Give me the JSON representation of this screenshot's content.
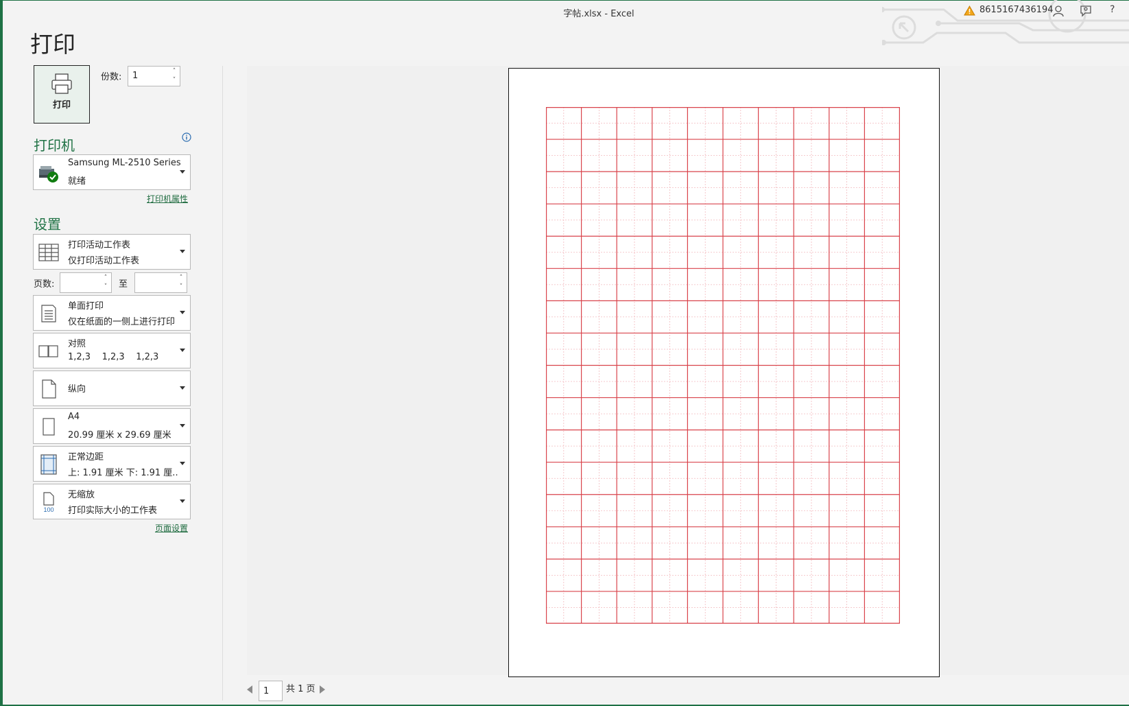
{
  "window": {
    "title": "字帖.xlsx  -  Excel",
    "account": "8615167436194",
    "help": "?"
  },
  "panel": {
    "title": "打印"
  },
  "print_button": {
    "label": "打印"
  },
  "copies": {
    "label": "份数:",
    "value": "1"
  },
  "printer": {
    "section": "打印机",
    "name": "Samsung ML-2510 Series",
    "status": "就绪",
    "properties_link": "打印机属性"
  },
  "settings": {
    "section": "设置",
    "scope": {
      "title": "打印活动工作表",
      "desc": "仅打印活动工作表"
    },
    "pages": {
      "label": "页数:",
      "from": "",
      "to_label": "至",
      "to": ""
    },
    "sides": {
      "title": "单面打印",
      "desc": "仅在纸面的一侧上进行打印"
    },
    "collate": {
      "title": "对照",
      "desc": "1,2,3    1,2,3    1,2,3"
    },
    "orientation": {
      "title": "纵向"
    },
    "paper": {
      "title": "A4",
      "desc": "20.99 厘米 x 29.69 厘米"
    },
    "margins": {
      "title": "正常边距",
      "desc": "上: 1.91 厘米 下: 1.91 厘..."
    },
    "scaling": {
      "title": "无缩放",
      "desc": "打印实际大小的工作表",
      "icon_text": "100"
    },
    "page_setup_link": "页面设置"
  },
  "preview": {
    "current_page": "1",
    "total_pages": "共 1 页",
    "grid": {
      "columns": 10,
      "rows": 16,
      "line_color": "#d9434b",
      "guide_color": "#f2b9bd"
    }
  },
  "colors": {
    "accent": "#217346",
    "grid_red": "#d9434b"
  }
}
